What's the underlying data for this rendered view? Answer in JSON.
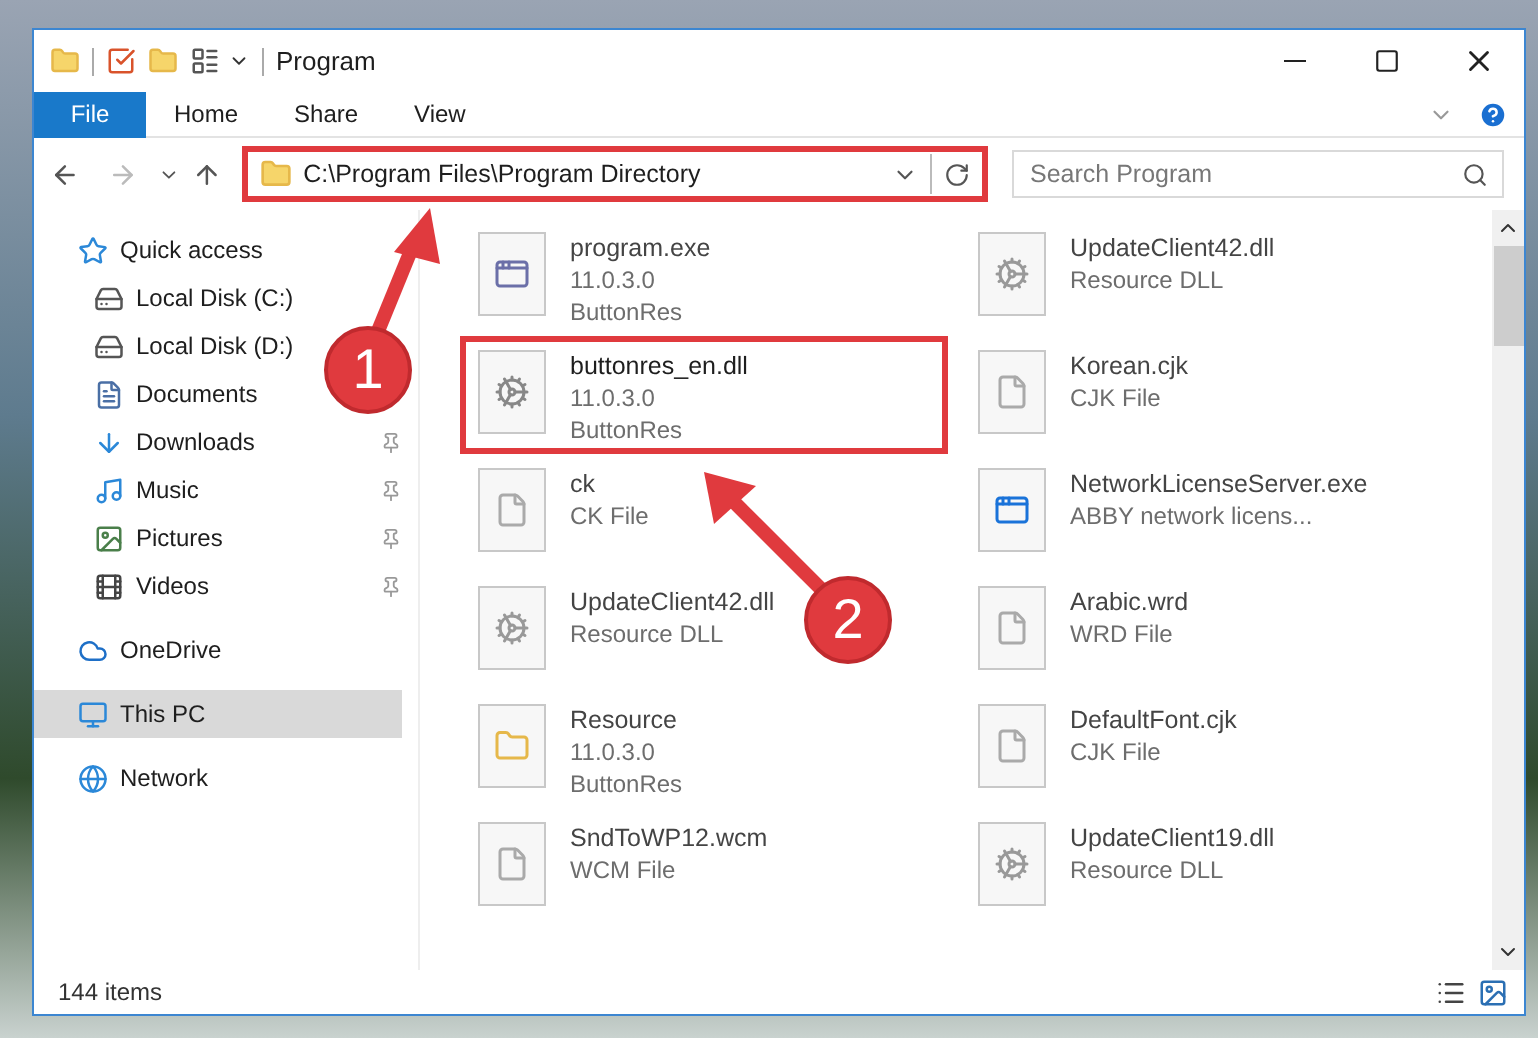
{
  "window": {
    "title": "Program"
  },
  "ribbon_tabs": [
    {
      "label": "File",
      "kind": "file"
    },
    {
      "label": "Home",
      "kind": "tab"
    },
    {
      "label": "Share",
      "kind": "tab"
    },
    {
      "label": "View",
      "kind": "tab"
    }
  ],
  "address_bar": {
    "path": "C:\\Program Files\\Program Directory",
    "highlighted": true
  },
  "search": {
    "placeholder": "Search Program"
  },
  "sidebar": {
    "items": [
      {
        "label": "Quick access",
        "selected": false,
        "children": [
          {
            "label": "Local Disk (C:)",
            "selected": false,
            "pinned": false
          },
          {
            "label": "Local Disk (D:)",
            "selected": false,
            "pinned": false
          },
          {
            "label": "Documents",
            "selected": false,
            "pinned": false
          },
          {
            "label": "Downloads",
            "selected": false,
            "pinned": true
          },
          {
            "label": "Music",
            "selected": false,
            "pinned": true
          },
          {
            "label": "Pictures",
            "selected": false,
            "pinned": true
          },
          {
            "label": "Videos",
            "selected": false,
            "pinned": true
          }
        ]
      },
      {
        "label": "OneDrive",
        "selected": false
      },
      {
        "label": "This PC",
        "selected": true
      },
      {
        "label": "Network",
        "selected": false
      }
    ]
  },
  "files": [
    {
      "name": "program.exe",
      "details": [
        "11.0.3.0",
        "ButtonRes"
      ],
      "highlighted": false
    },
    {
      "name": "UpdateClient42.dll",
      "details": [
        "Resource DLL"
      ],
      "highlighted": false
    },
    {
      "name": "buttonres_en.dll",
      "details": [
        "11.0.3.0",
        "ButtonRes"
      ],
      "highlighted": true
    },
    {
      "name": "Korean.cjk",
      "details": [
        "CJK File"
      ],
      "highlighted": false
    },
    {
      "name": "ck",
      "details": [
        "CK File"
      ],
      "highlighted": false
    },
    {
      "name": "NetworkLicenseServer.exe",
      "details": [
        "ABBY network licens..."
      ],
      "highlighted": false
    },
    {
      "name": "UpdateClient42.dll",
      "details": [
        "Resource DLL"
      ],
      "highlighted": false
    },
    {
      "name": "Arabic.wrd",
      "details": [
        "WRD File"
      ],
      "highlighted": false
    },
    {
      "name": "Resource",
      "details": [
        "11.0.3.0",
        "ButtonRes"
      ],
      "highlighted": false
    },
    {
      "name": "DefaultFont.cjk",
      "details": [
        "CJK File"
      ],
      "highlighted": false
    },
    {
      "name": "SndToWP12.wcm",
      "details": [
        "WCM File"
      ],
      "highlighted": false
    },
    {
      "name": "UpdateClient19.dll",
      "details": [
        "Resource DLL"
      ],
      "highlighted": false
    }
  ],
  "annotations": [
    {
      "label": "1"
    },
    {
      "label": "2"
    }
  ],
  "status_bar": {
    "count": "144 items"
  }
}
